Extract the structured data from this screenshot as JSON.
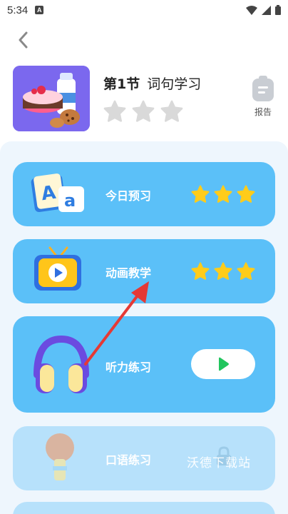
{
  "status_bar": {
    "time": "5:34",
    "notification_badge": "A"
  },
  "header": {
    "lesson_number": "第1节",
    "lesson_name": "词句学习",
    "lesson_stars_earned": 0,
    "lesson_stars_total": 3,
    "report_label": "报告"
  },
  "cards": [
    {
      "title": "今日预习",
      "icon": "letters-book-icon",
      "stars_earned": 3,
      "stars_total": 3,
      "locked": false
    },
    {
      "title": "动画教学",
      "icon": "tv-play-icon",
      "stars_earned": 3,
      "stars_total": 3,
      "locked": false
    },
    {
      "title": "听力练习",
      "icon": "headphones-icon",
      "action": "play",
      "locked": false
    },
    {
      "title": "口语练习",
      "icon": "microphone-icon",
      "locked": true
    }
  ],
  "watermark": "沃德下载站",
  "colors": {
    "card_blue": "#5bc0f8",
    "card_locked": "#b7e1fb",
    "panel_bg": "#eef6fd",
    "star_gold": "#ffcc1a",
    "star_gray": "#d9d9d9",
    "play_green": "#22c55e",
    "arrow_red": "#e53935"
  }
}
